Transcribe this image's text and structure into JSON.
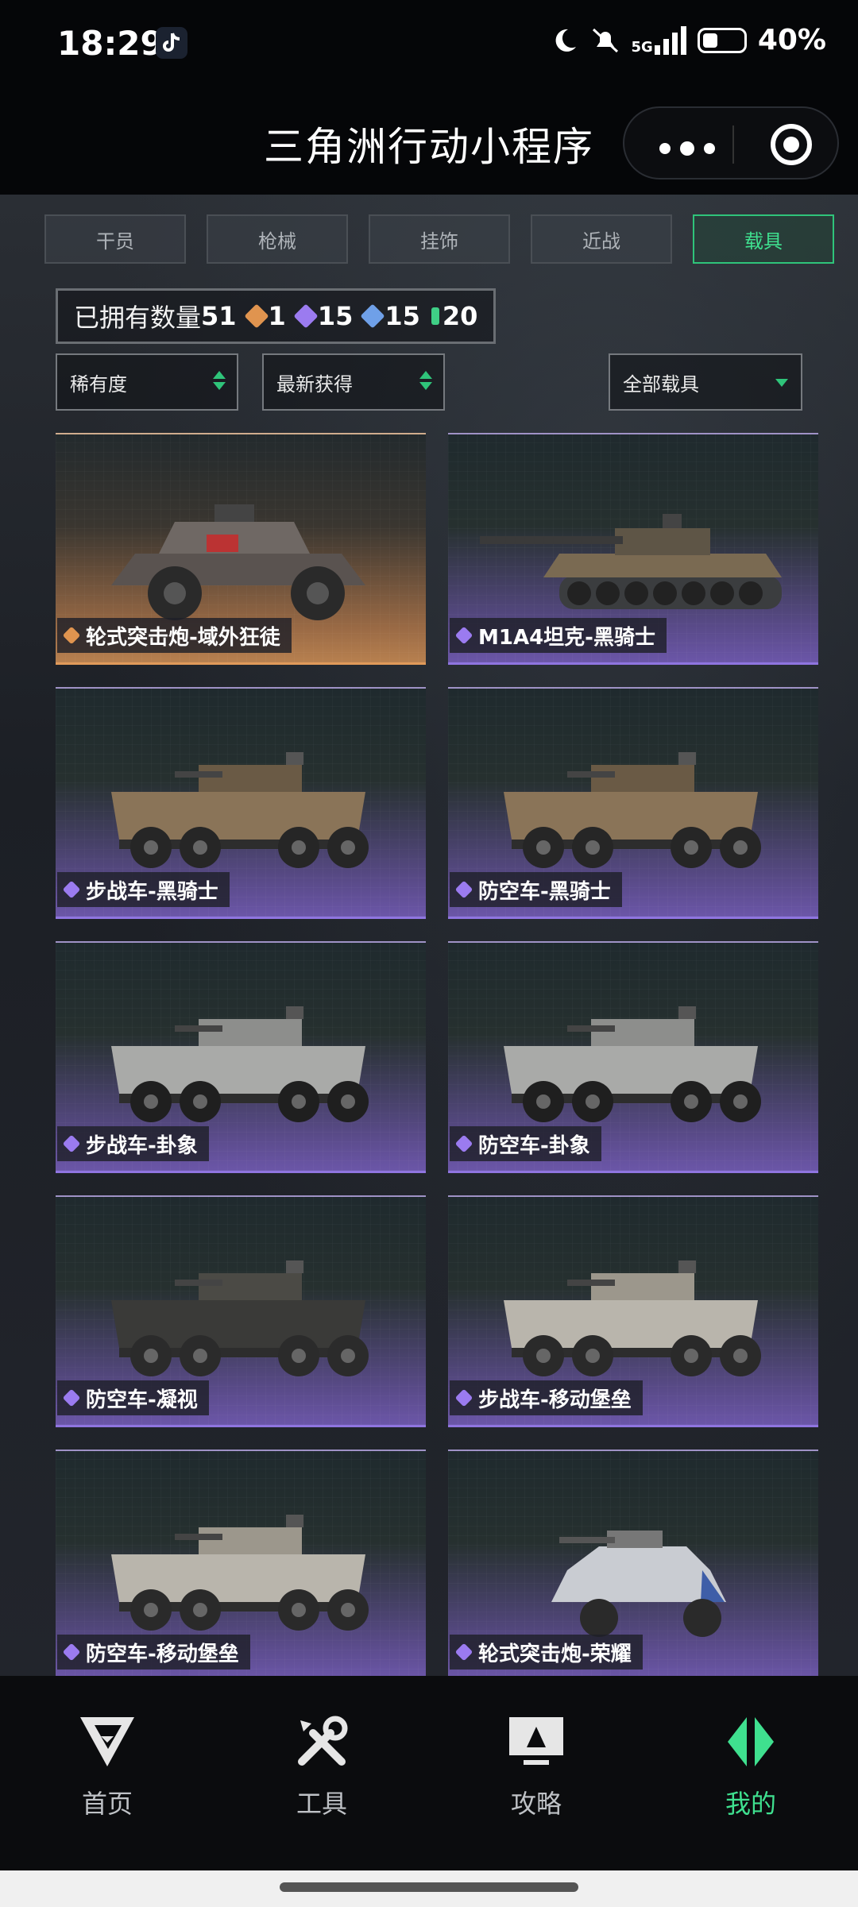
{
  "status_bar": {
    "time": "18:29",
    "network": "5G",
    "battery": "40%"
  },
  "title_bar": {
    "title": "三角洲行动小程序"
  },
  "tabs": [
    {
      "label": "干员",
      "active": false
    },
    {
      "label": "枪械",
      "active": false
    },
    {
      "label": "挂饰",
      "active": false
    },
    {
      "label": "近战",
      "active": false
    },
    {
      "label": "载具",
      "active": true
    }
  ],
  "summary": {
    "owned_label": "已拥有数量",
    "owned_count": "51",
    "rarities": [
      {
        "count": "1",
        "color": "#e0944f"
      },
      {
        "count": "15",
        "color": "#9b7bf0"
      },
      {
        "count": "15",
        "color": "#6fa0e8"
      },
      {
        "count": "20",
        "color": "#3fcf86"
      }
    ]
  },
  "filters": {
    "rarity": "稀有度",
    "sort": "最新获得",
    "category": "全部载具"
  },
  "vehicles": [
    {
      "name": "轮式突击炮-域外狂徒",
      "rarity": "orange",
      "kind": "buggy"
    },
    {
      "name": "M1A4坦克-黑骑士",
      "rarity": "purple",
      "kind": "tank"
    },
    {
      "name": "步战车-黑骑士",
      "rarity": "purple",
      "kind": "ifv"
    },
    {
      "name": "防空车-黑骑士",
      "rarity": "purple",
      "kind": "ifv"
    },
    {
      "name": "步战车-卦象",
      "rarity": "purple",
      "kind": "ifv-light"
    },
    {
      "name": "防空车-卦象",
      "rarity": "purple",
      "kind": "ifv-light"
    },
    {
      "name": "防空车-凝视",
      "rarity": "purple",
      "kind": "ifv-dark"
    },
    {
      "name": "步战车-移动堡垒",
      "rarity": "purple",
      "kind": "ifv-white"
    },
    {
      "name": "防空车-移动堡垒",
      "rarity": "purple",
      "kind": "ifv-white"
    },
    {
      "name": "轮式突击炮-荣耀",
      "rarity": "purple",
      "kind": "car"
    }
  ],
  "bottom_nav": [
    {
      "label": "首页",
      "icon": "home-logo-icon",
      "active": false
    },
    {
      "label": "工具",
      "icon": "tools-icon",
      "active": false
    },
    {
      "label": "攻略",
      "icon": "guide-monitor-icon",
      "active": false
    },
    {
      "label": "我的",
      "icon": "profile-logo-icon",
      "active": true
    }
  ]
}
